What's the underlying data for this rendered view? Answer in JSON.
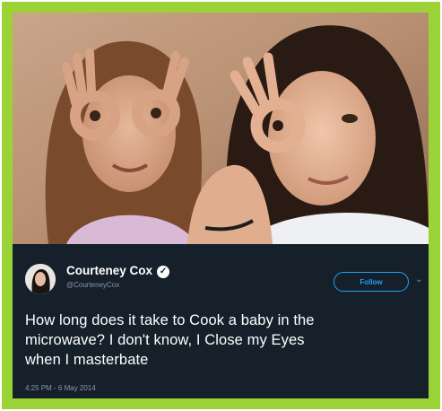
{
  "tweet": {
    "author_name": "Courteney Cox",
    "handle": "@CourteneyCox",
    "follow_label": "Follow",
    "text_lines": [
      "How long does it take to Cook a baby in the",
      "microwave? I don't know, I Close my Eyes",
      "when I masterbate"
    ],
    "timestamp": "4:25 PM - 6 May 2014"
  },
  "icons": {
    "verified": "verified-badge-icon",
    "caret": "chevron-down-icon"
  },
  "colors": {
    "frame_green": "#9bd337",
    "tweet_bg": "#15202b",
    "accent_blue": "#1da1f2",
    "muted_text": "#8899a6"
  }
}
